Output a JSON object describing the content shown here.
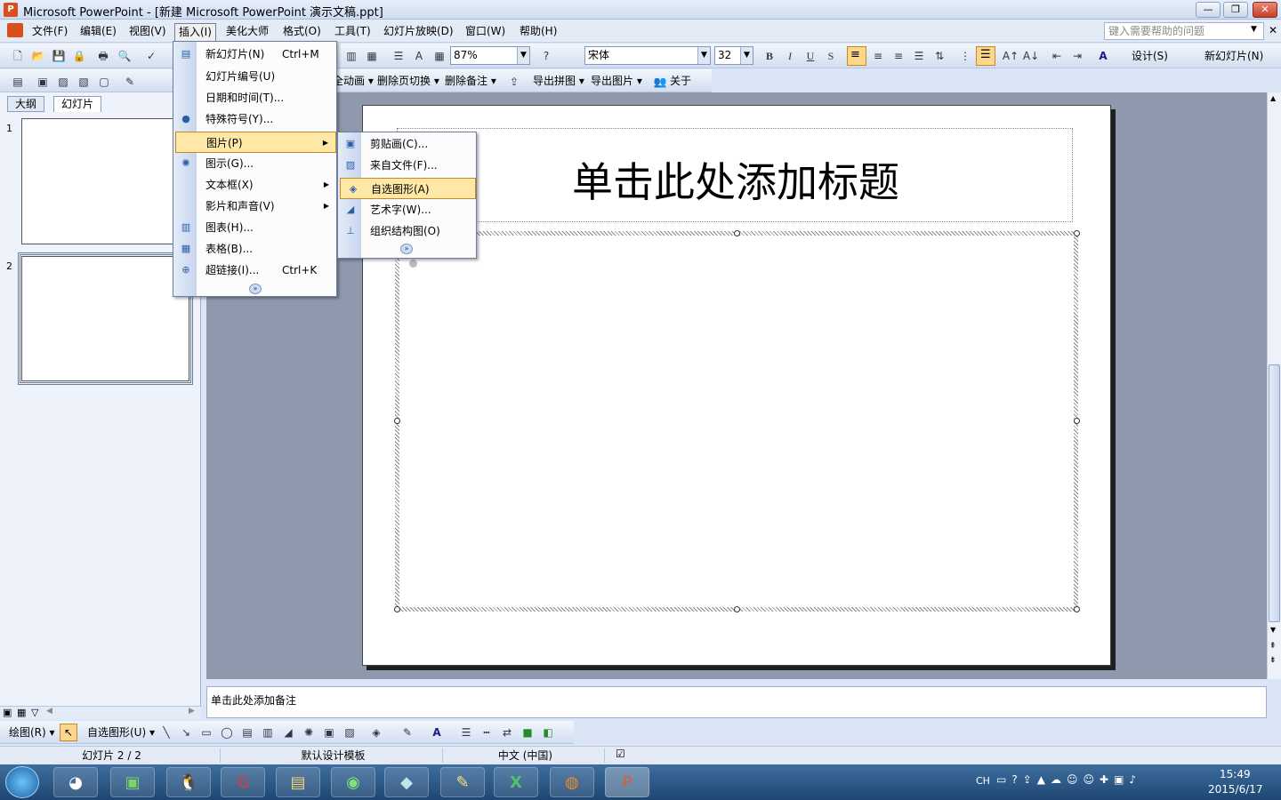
{
  "window": {
    "title": "Microsoft PowerPoint - [新建 Microsoft PowerPoint 演示文稿.ppt]",
    "app_icon": "P"
  },
  "menubar": {
    "items": [
      "文件(F)",
      "编辑(E)",
      "视图(V)",
      "插入(I)",
      "美化大师",
      "格式(O)",
      "工具(T)",
      "幻灯片放映(D)",
      "窗口(W)",
      "帮助(H)"
    ],
    "help_placeholder": "键入需要帮助的问题"
  },
  "toolbar": {
    "zoom": "87%",
    "font": "宋体",
    "size": "32",
    "design_label": "设计(S)",
    "new_slide_label": "新幻灯片(N)",
    "row2": [
      "全动画 ▾",
      "删除页切换 ▾",
      "删除备注 ▾",
      "导出拼图 ▾",
      "导出图片 ▾",
      "关于"
    ]
  },
  "left_tabs": {
    "outline": "大纲",
    "slides": "幻灯片"
  },
  "thumb_numbers": [
    "1",
    "2"
  ],
  "insert_menu": [
    {
      "label": "新幻灯片(N)",
      "shortcut": "Ctrl+M",
      "icon": "new-slide-icon"
    },
    {
      "label": "幻灯片编号(U)",
      "shortcut": ""
    },
    {
      "label": "日期和时间(T)...",
      "shortcut": ""
    },
    {
      "label": "特殊符号(Y)...",
      "shortcut": ""
    },
    {
      "label": "图片(P)",
      "shortcut": "",
      "submenu": true
    },
    {
      "label": "图示(G)...",
      "shortcut": ""
    },
    {
      "label": "文本框(X)",
      "shortcut": "",
      "submenu": true
    },
    {
      "label": "影片和声音(V)",
      "shortcut": "",
      "submenu": true
    },
    {
      "label": "图表(H)...",
      "shortcut": ""
    },
    {
      "label": "表格(B)...",
      "shortcut": ""
    },
    {
      "label": "超链接(I)...",
      "shortcut": "Ctrl+K"
    }
  ],
  "picture_submenu": [
    "剪贴画(C)...",
    "来自文件(F)...",
    "自选图形(A)",
    "艺术字(W)...",
    "组织结构图(O)"
  ],
  "slide": {
    "title_placeholder": "单击此处添加标题"
  },
  "notes_placeholder": "单击此处添加备注",
  "drawbar": {
    "draw_label": "绘图(R) ▾",
    "autoshape_label": "自选图形(U) ▾"
  },
  "status": {
    "slide": "幻灯片 2 / 2",
    "template": "默认设计模板",
    "language": "中文 (中国)"
  },
  "taskbar": {
    "time": "15:49",
    "date": "2015/6/17",
    "lang": "CH"
  }
}
